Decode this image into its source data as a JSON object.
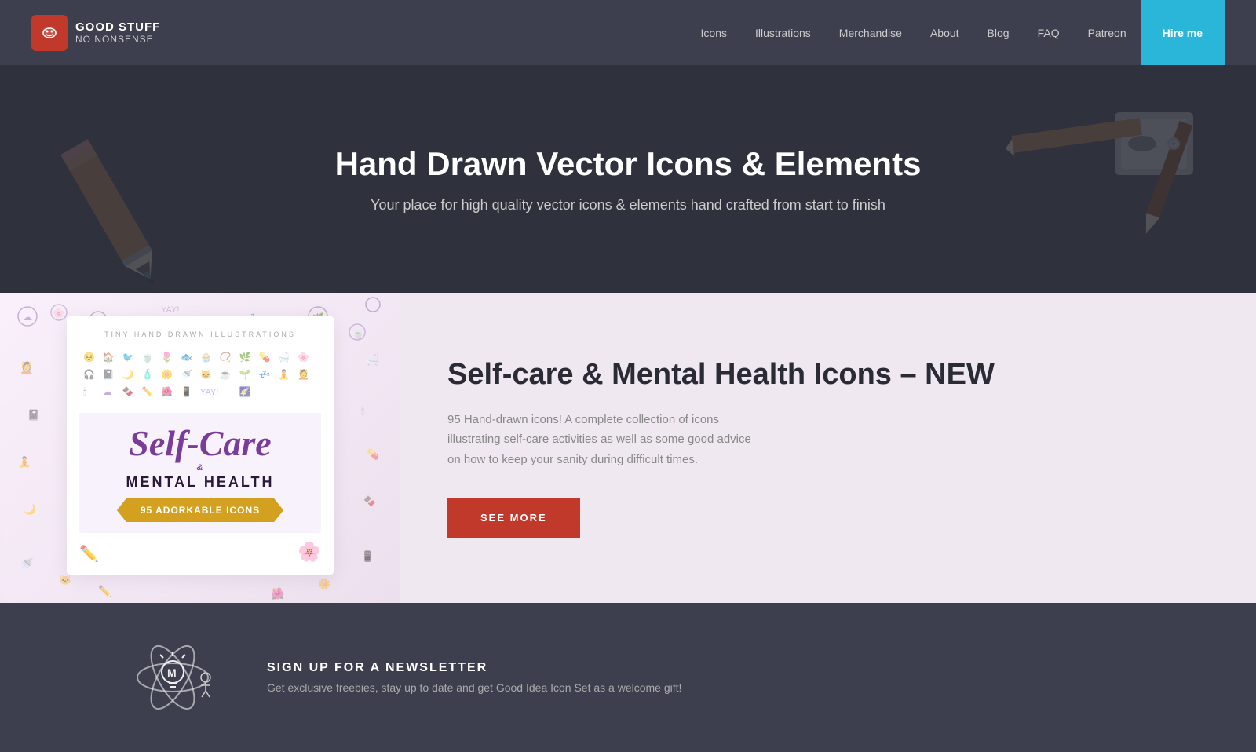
{
  "header": {
    "logo": {
      "icon": "😊",
      "line1": "GOOD STUFF",
      "line2": "NO NONSENSE"
    },
    "nav": {
      "items": [
        {
          "label": "Icons",
          "href": "#"
        },
        {
          "label": "Illustrations",
          "href": "#"
        },
        {
          "label": "Merchandise",
          "href": "#"
        },
        {
          "label": "About",
          "href": "#"
        },
        {
          "label": "Blog",
          "href": "#"
        },
        {
          "label": "FAQ",
          "href": "#"
        },
        {
          "label": "Patreon",
          "href": "#"
        }
      ],
      "cta": {
        "label": "Hire me",
        "href": "#"
      }
    }
  },
  "hero": {
    "title": "Hand Drawn Vector Icons & Elements",
    "subtitle": "Your place for high quality vector icons & elements hand crafted from start to finish"
  },
  "feature": {
    "card": {
      "tiny_label": "TINY HAND DRAWN ILLUSTRATIONS",
      "title_line1": "Self-Care",
      "title_ampersand": "&",
      "title_line2": "MENTAL HEALTH",
      "ribbon": "95 ADORKABLE ICONS"
    },
    "title": "Self-care & Mental Health Icons – NEW",
    "description": "95 Hand-drawn icons! A complete collection of icons illustrating self-care activities as well as some good advice on how to keep your sanity during difficult times.",
    "cta_label": "SEE MORE"
  },
  "newsletter": {
    "title": "SIGN UP FOR A NEWSLETTER",
    "description": "Get exclusive freebies, stay up to date and get Good Idea Icon Set as a welcome gift!"
  }
}
